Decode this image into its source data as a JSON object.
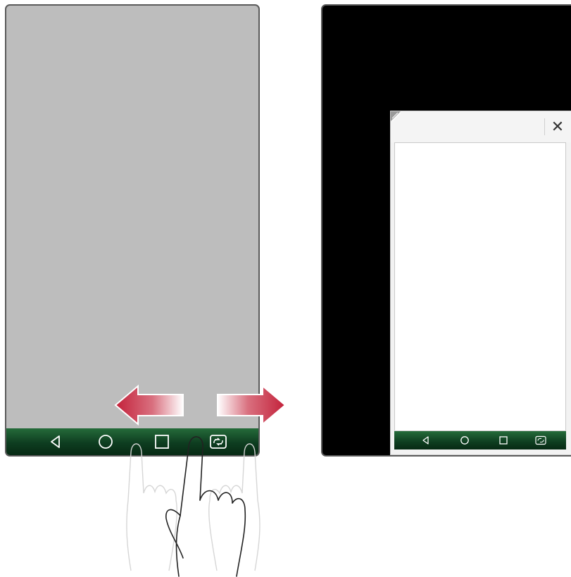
{
  "colors": {
    "left_screen": "#bdbdbd",
    "right_screen": "#000000",
    "navbar_green": "#0e3d20",
    "arrow_red": "#c8283c"
  },
  "left_phone": {
    "navbar": {
      "buttons": [
        "back-icon",
        "home-icon",
        "recents-icon",
        "dual-window-icon"
      ]
    },
    "gesture": {
      "arrows": [
        "arrow-left-icon",
        "arrow-right-icon"
      ],
      "hand": "swipe-hand-icon"
    }
  },
  "right_phone": {
    "popup": {
      "close_label": "✕",
      "navbar": {
        "buttons": [
          "back-icon",
          "home-icon",
          "recents-icon",
          "dual-window-icon"
        ]
      }
    }
  }
}
